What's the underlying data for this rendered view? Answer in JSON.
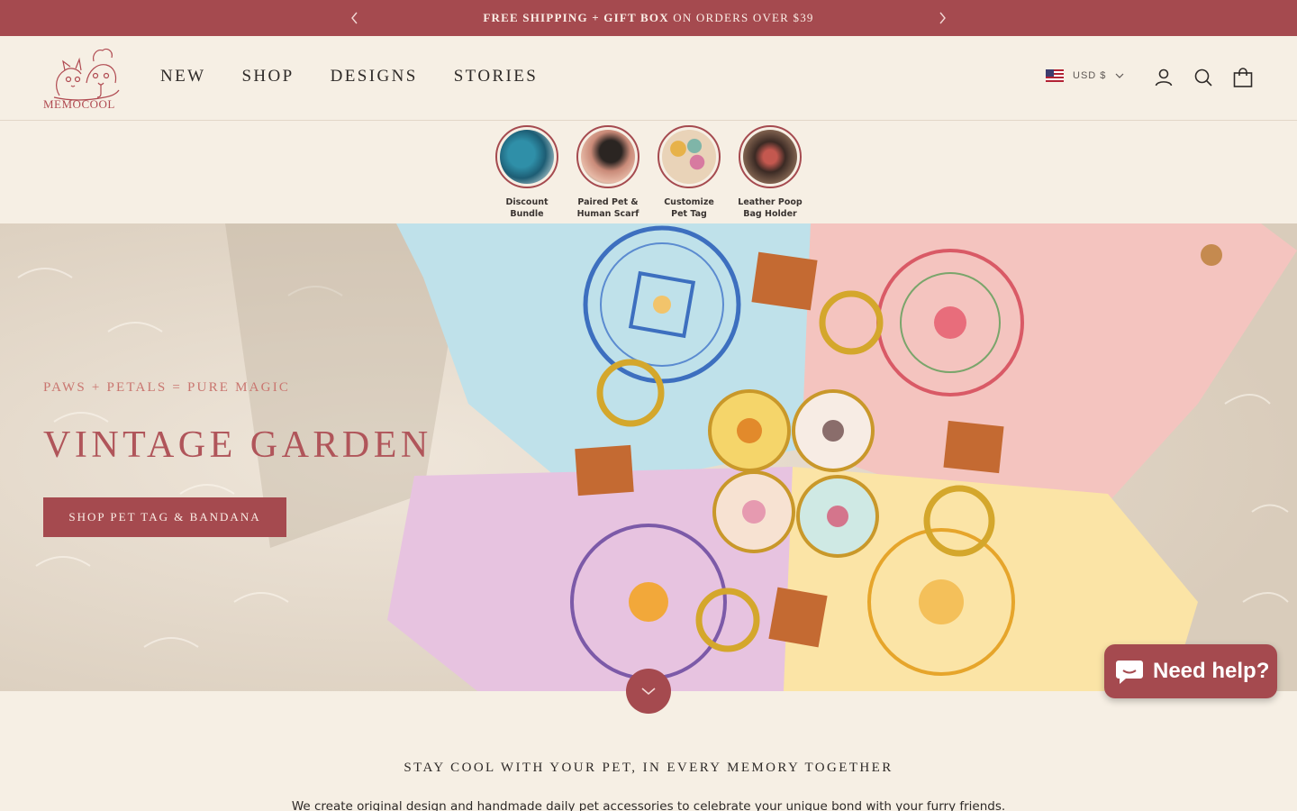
{
  "announcement": {
    "bold_text": "FREE SHIPPING + GIFT BOX",
    "text": " ON ORDERS OVER $39"
  },
  "brand": {
    "logo_text": "MEMOCOOL",
    "primary_color": "#a54a4f",
    "background_color": "#f6efe4"
  },
  "nav": {
    "items": [
      "NEW",
      "SHOP",
      "DESIGNS",
      "STORIES"
    ]
  },
  "header_actions": {
    "currency": "USD $",
    "icons": [
      "account-icon",
      "search-icon",
      "cart-icon"
    ]
  },
  "categories": [
    {
      "line1": "Discount",
      "line2": "Bundle"
    },
    {
      "line1": "Paired Pet &",
      "line2": "Human Scarf"
    },
    {
      "line1": "Customize",
      "line2": "Pet Tag"
    },
    {
      "line1": "Leather Poop",
      "line2": "Bag Holder"
    }
  ],
  "hero": {
    "eyebrow": "PAWS + PETALS = PURE MAGIC",
    "title": "VINTAGE GARDEN",
    "cta": "SHOP PET TAG & BANDANA"
  },
  "chat": {
    "label": "Need help?"
  },
  "intro": {
    "tagline": "STAY COOL WITH YOUR PET, IN EVERY MEMORY TOGETHER",
    "text": "We create original design and handmade daily pet accessories to celebrate your unique bond with your furry friends."
  }
}
